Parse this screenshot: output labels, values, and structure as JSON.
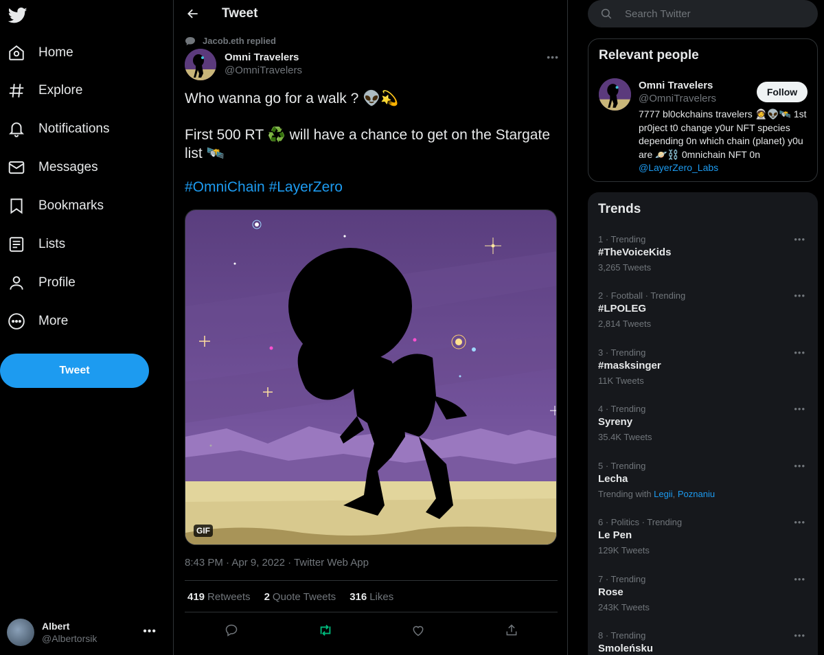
{
  "nav": {
    "items": [
      {
        "label": "Home",
        "icon": "home-icon"
      },
      {
        "label": "Explore",
        "icon": "hashtag-icon"
      },
      {
        "label": "Notifications",
        "icon": "bell-icon"
      },
      {
        "label": "Messages",
        "icon": "envelope-icon"
      },
      {
        "label": "Bookmarks",
        "icon": "bookmark-icon"
      },
      {
        "label": "Lists",
        "icon": "list-icon"
      },
      {
        "label": "Profile",
        "icon": "person-icon"
      },
      {
        "label": "More",
        "icon": "more-circle-icon"
      }
    ],
    "tweet_button": "Tweet",
    "account": {
      "name": "Albert",
      "handle": "@Albertorsik",
      "more": "•••"
    }
  },
  "main": {
    "title": "Tweet",
    "replied_label": "Jacob.eth replied",
    "author": {
      "name": "Omni Travelers",
      "handle": "@OmniTravelers",
      "more": "•••"
    },
    "text_line1": "Who wanna go for a walk ? 👽💫",
    "text_line2": "First 500 RT ♻️ will have a chance to get on the Stargate list 🛰️",
    "hashtag1": "#OmniChain",
    "hashtag2": "#LayerZero",
    "gif_badge": "GIF",
    "timestamp": "8:43 PM · Apr 9, 2022 · Twitter Web App",
    "stats": {
      "retweets_num": "419",
      "retweets_label": "Retweets",
      "quotes_num": "2",
      "quotes_label": "Quote Tweets",
      "likes_num": "316",
      "likes_label": "Likes"
    }
  },
  "search": {
    "placeholder": "Search Twitter"
  },
  "relevant": {
    "title": "Relevant people",
    "name": "Omni Travelers",
    "handle": "@OmniTravelers",
    "follow": "Follow",
    "bio": "7777 bl0ckchains travelers 🧑‍🚀👽🛰️ 1st pr0ject t0 change y0ur NFT species depending 0n which chain (planet) y0u are 🪐⛓️ 0mnichain NFT 0n ",
    "bio_link": "@LayerZero_Labs"
  },
  "trends": {
    "title": "Trends",
    "items": [
      {
        "meta": "1 · Trending",
        "name": "#TheVoiceKids",
        "count": "3,265 Tweets"
      },
      {
        "meta": "2 · Football · Trending",
        "name": "#LPOLEG",
        "count": "2,814 Tweets"
      },
      {
        "meta": "3 · Trending",
        "name": "#masksinger",
        "count": "11K Tweets"
      },
      {
        "meta": "4 · Trending",
        "name": "Syreny",
        "count": "35.4K Tweets"
      },
      {
        "meta": "5 · Trending",
        "name": "Lecha",
        "count_prefix": "Trending with ",
        "count_link1": "Legii",
        "count_sep": ", ",
        "count_link2": "Poznaniu"
      },
      {
        "meta": "6 · Politics · Trending",
        "name": "Le Pen",
        "count": "129K Tweets"
      },
      {
        "meta": "7 · Trending",
        "name": "Rose",
        "count": "243K Tweets"
      },
      {
        "meta": "8 · Trending",
        "name": "Smoleńsku",
        "count": ""
      }
    ],
    "more": "•••"
  },
  "colors": {
    "accent": "#1d9bf0",
    "retweet_green": "#00ba7c",
    "background": "#000000"
  }
}
